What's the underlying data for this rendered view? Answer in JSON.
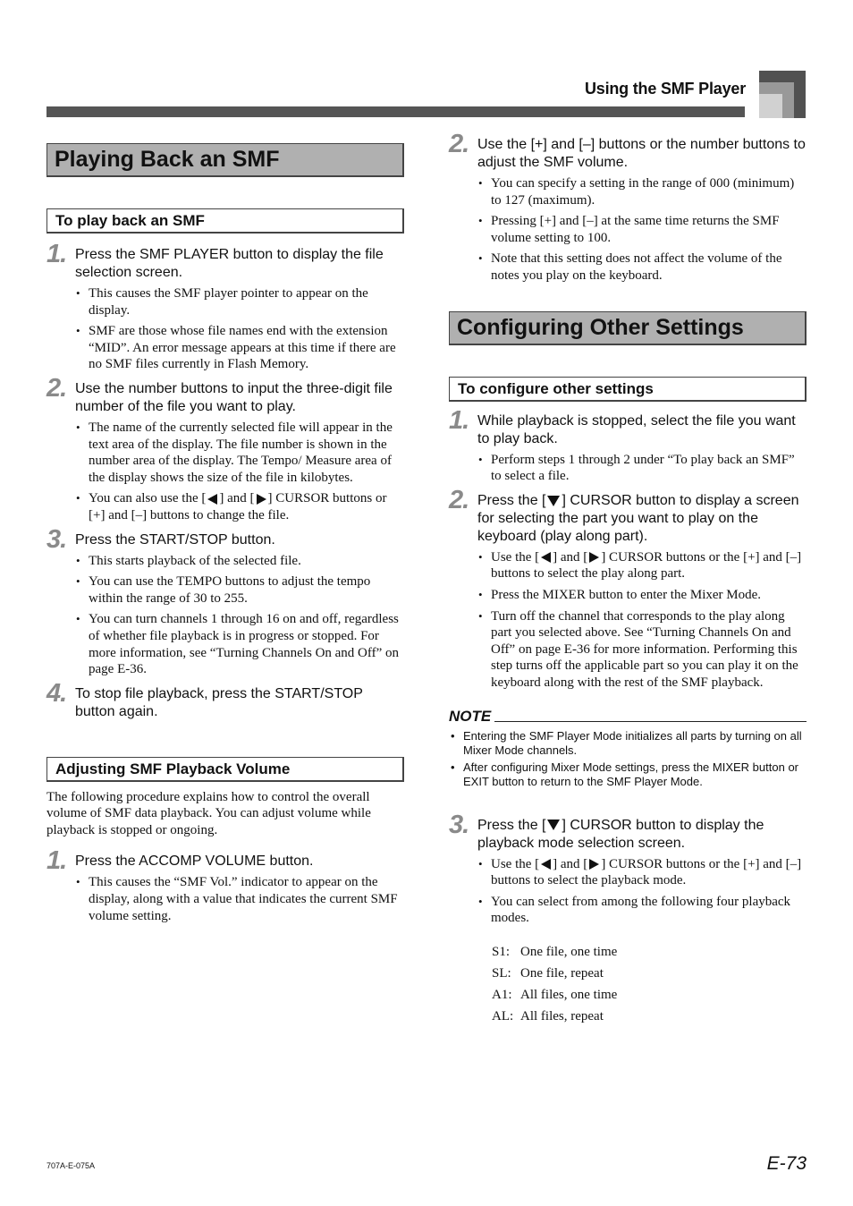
{
  "header": {
    "title": "Using the SMF Player"
  },
  "left": {
    "section_title": "Playing Back an SMF",
    "subsection1": {
      "title": "To play back an SMF",
      "steps": [
        {
          "num": "1.",
          "text": "Press the SMF PLAYER button to display the file selection screen.",
          "bullets": [
            "This causes the SMF player pointer to appear on the display.",
            "SMF are those whose file names end with the extension “MID”. An error message appears at this time if there are no SMF files currently in Flash Memory."
          ]
        },
        {
          "num": "2.",
          "text": "Use the number buttons to input the three-digit file number of the file you want to play.",
          "bullets": [
            "The name of the currently selected file will appear in the text area of the display. The file number is shown in the number area of the display. The Tempo/ Measure area of the display shows the size of the file in kilobytes."
          ],
          "cursor_bullet": {
            "pre": "You can also use the [",
            "mid": "] and [",
            "post": "] CURSOR buttons or [+] and [–] buttons to change the file."
          }
        },
        {
          "num": "3.",
          "text": "Press the START/STOP button.",
          "bullets": [
            "This starts playback of the selected file.",
            "You can use the TEMPO buttons to adjust the tempo within the range of 30 to 255.",
            "You can turn channels 1 through 16 on and off, regardless of whether file playback is in progress or stopped. For more information, see “Turning Channels On and Off” on page E-36."
          ]
        },
        {
          "num": "4.",
          "text": "To stop file playback, press the START/STOP button again."
        }
      ]
    },
    "subsection2": {
      "title": "Adjusting SMF Playback Volume",
      "intro": "The following procedure explains how to control the overall volume of SMF data playback. You can adjust volume while playback is stopped or ongoing.",
      "steps": [
        {
          "num": "1.",
          "text": "Press the ACCOMP VOLUME button.",
          "bullets": [
            "This causes the “SMF Vol.” indicator to appear on the display, along with a value that indicates the current SMF volume setting."
          ]
        }
      ]
    }
  },
  "right": {
    "vol_step2": {
      "num": "2.",
      "text": "Use the [+] and [–] buttons or the number buttons to adjust the SMF volume.",
      "bullets": [
        "You can specify a setting in the range of 000 (minimum) to 127 (maximum).",
        "Pressing [+] and [–] at the same time returns the SMF volume setting to 100.",
        "Note that this setting does not affect the volume of the notes you play on the keyboard."
      ]
    },
    "section_title": "Configuring Other Settings",
    "subsection": {
      "title": "To configure other settings",
      "step1": {
        "num": "1.",
        "text": "While playback is stopped, select the file you want to play back.",
        "bullets": [
          "Perform steps 1 through 2 under “To play back an SMF” to select a file."
        ]
      },
      "step2": {
        "num": "2.",
        "text_pre": "Press the [",
        "text_post": "] CURSOR button to display a screen for selecting the part you want to play on the keyboard (play along part).",
        "cursor_bullet": {
          "pre": "Use the [",
          "mid": "] and [",
          "post": "] CURSOR buttons or the [+] and [–] buttons to select the play along part."
        },
        "bullets": [
          "Press the MIXER button to enter the Mixer Mode.",
          "Turn off the channel that corresponds to the play along part you selected above. See “Turning Channels On and Off” on page E-36 for more information. Performing this step turns off the applicable part so you can play it on the keyboard along with the rest of the SMF playback."
        ]
      },
      "note": {
        "label": "NOTE",
        "items": [
          "Entering the SMF Player Mode initializes all parts by turning on all Mixer Mode channels.",
          "After configuring Mixer Mode settings, press the MIXER button or EXIT button to return to the SMF Player Mode."
        ]
      },
      "step3": {
        "num": "3.",
        "text_pre": "Press the [",
        "text_post": "] CURSOR button to display the playback mode selection screen.",
        "cursor_bullet": {
          "pre": "Use the [",
          "mid": "] and [",
          "post": "] CURSOR buttons or the [+] and [–] buttons to select the playback mode."
        },
        "bullets": [
          "You can select from among the following four playback modes."
        ],
        "modes": [
          {
            "code": "S1:",
            "desc": "One file, one time"
          },
          {
            "code": "SL:",
            "desc": "One file, repeat"
          },
          {
            "code": "A1:",
            "desc": "All files, one time"
          },
          {
            "code": "AL:",
            "desc": "All files, repeat"
          }
        ]
      }
    }
  },
  "footer": {
    "code": "707A-E-075A",
    "page": "E-73"
  }
}
